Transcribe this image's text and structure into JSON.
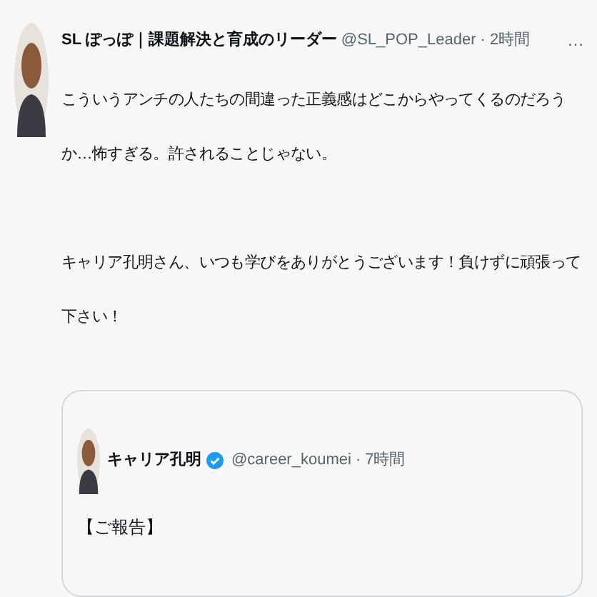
{
  "tweet": {
    "author": {
      "name": "SL ぽっぽ｜課題解決と育成のリーダー",
      "handle": "@SL_POP_Leader",
      "separator": "·",
      "time": "2時間",
      "more": "…"
    },
    "paragraphs": [
      "こういうアンチの人たちの間違った正義感はどこからやってくるのだろうか…怖すぎる。許されることじゃない。",
      "キャリア孔明さん、いつも学びをありがとうございます！負けずに頑張って下さい！"
    ],
    "quote": {
      "author": {
        "name": "キャリア孔明",
        "verified": true,
        "handle": "@career_koumei",
        "separator": "·",
        "time": "7時間"
      },
      "text": "【ご報告】"
    }
  }
}
